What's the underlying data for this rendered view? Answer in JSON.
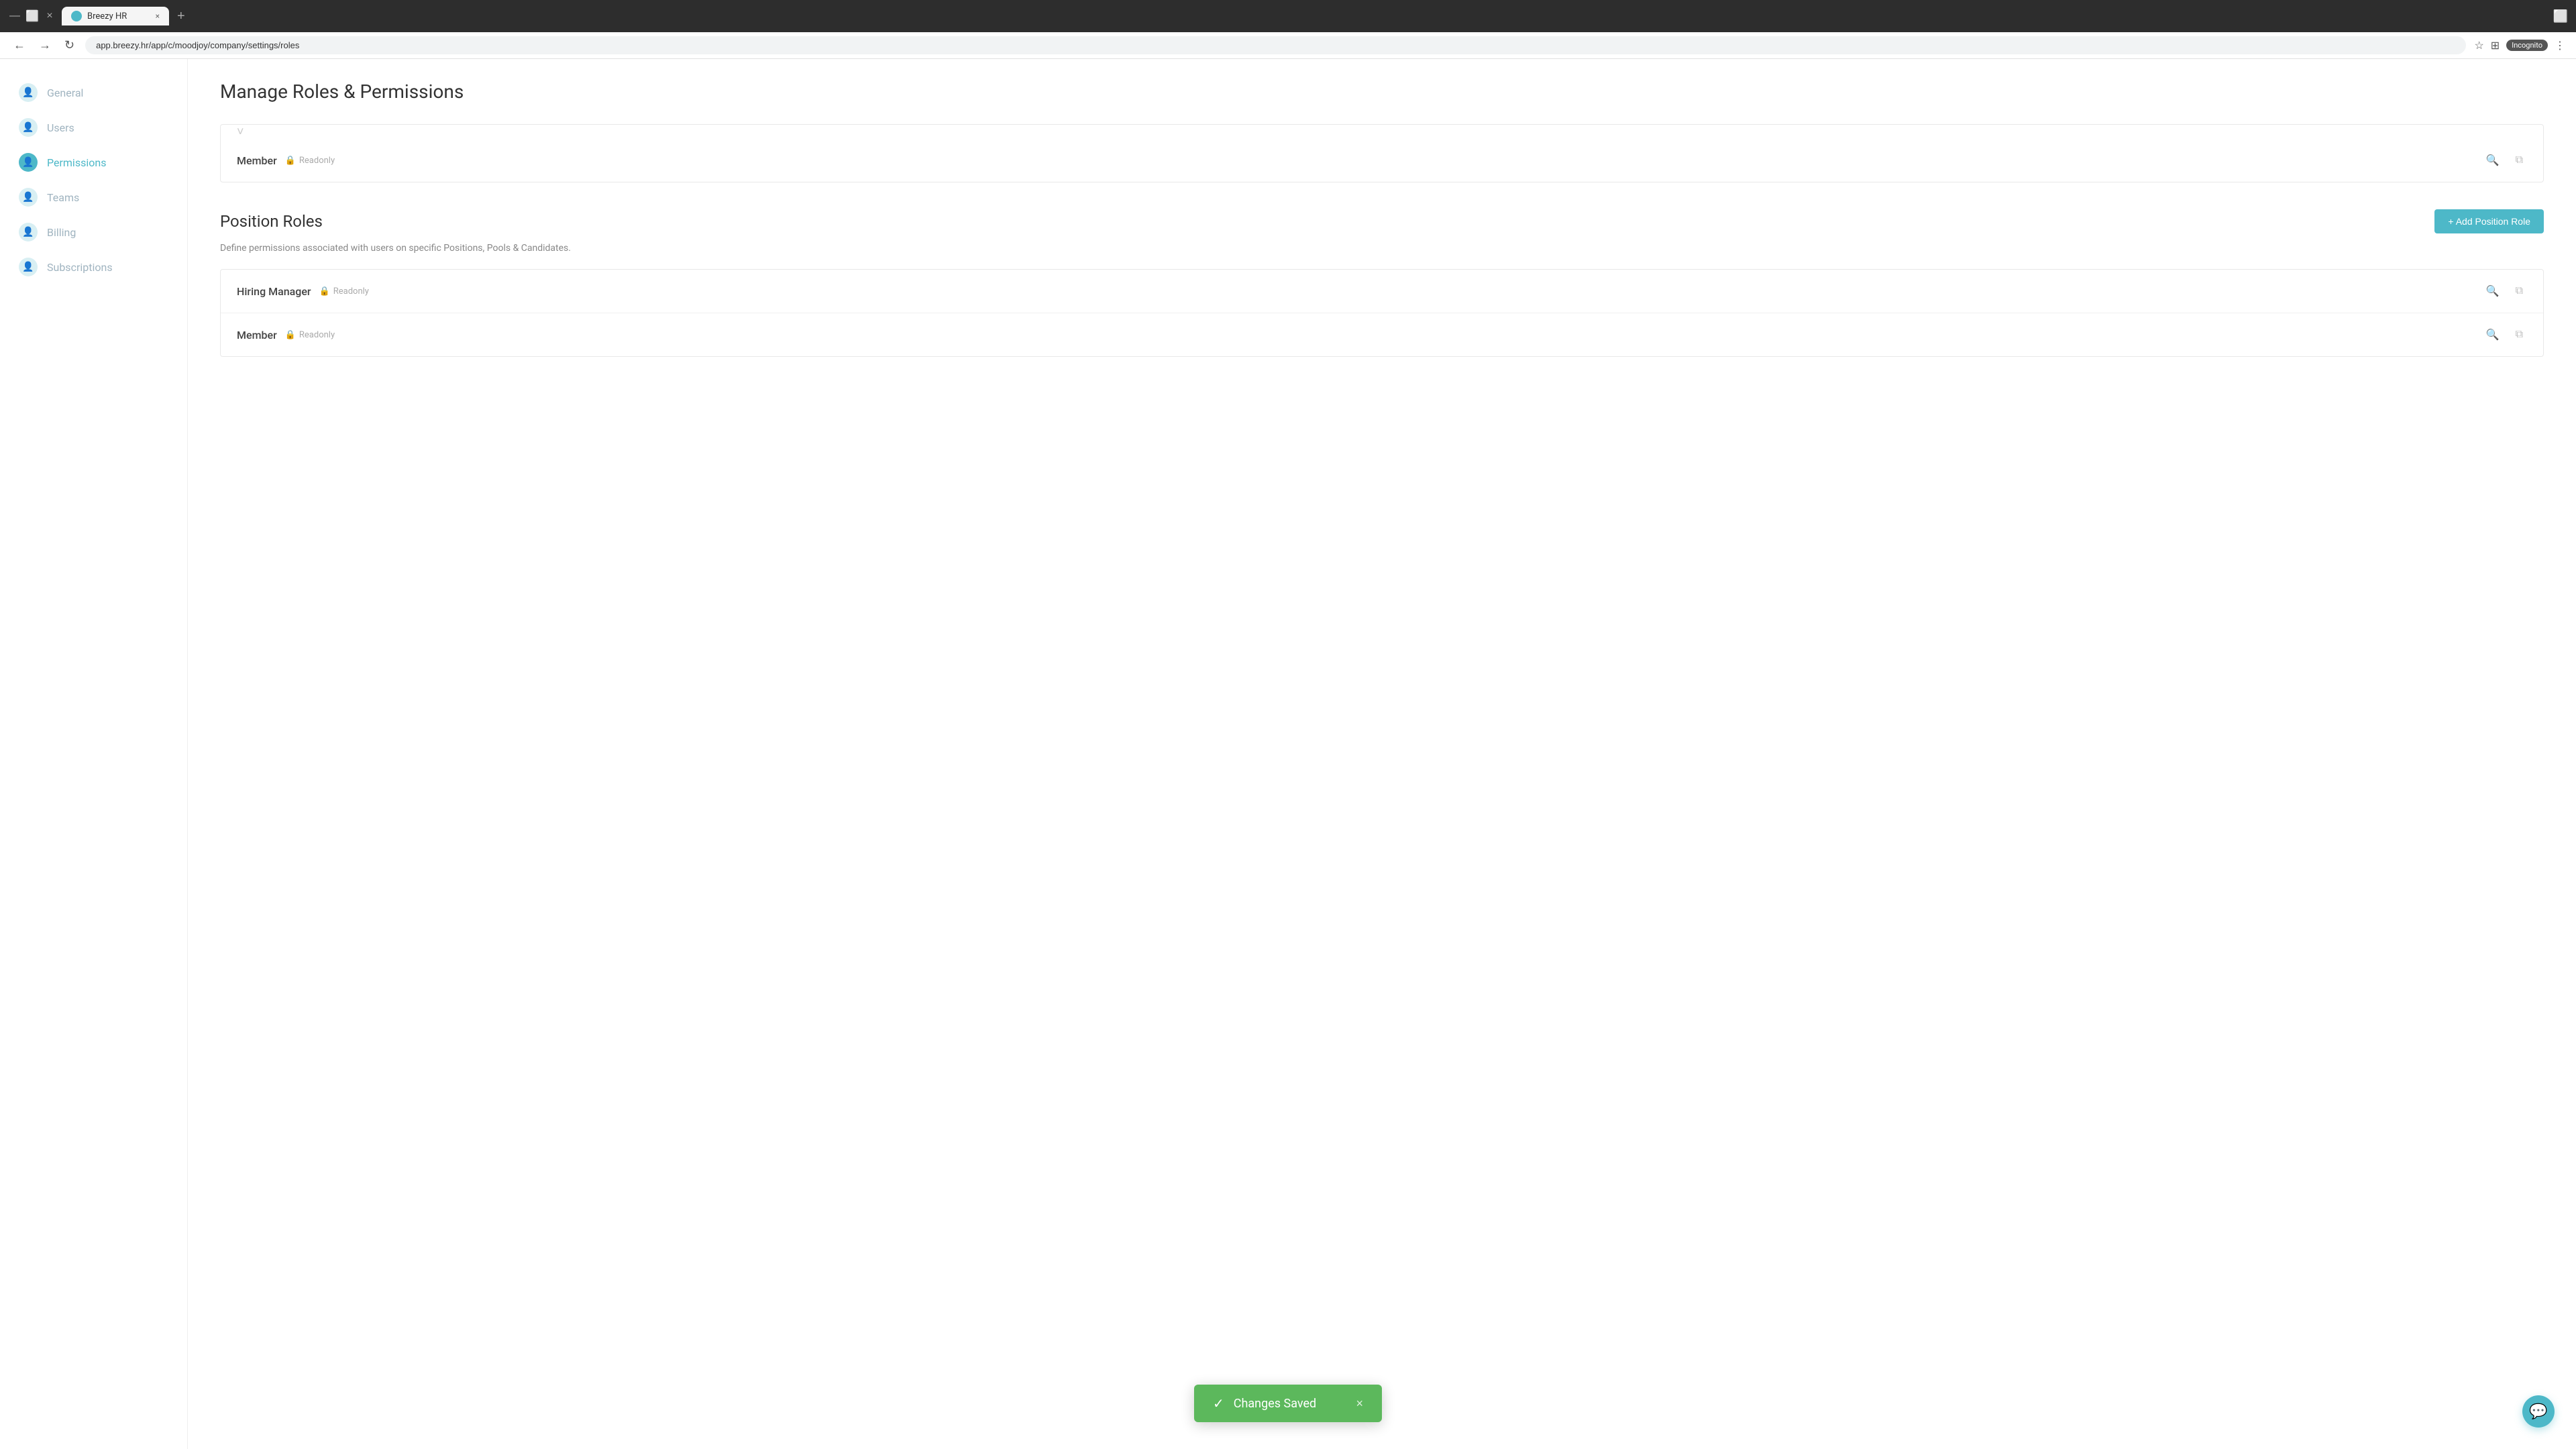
{
  "browser": {
    "tab_title": "Breezy HR",
    "url": "app.breezy.hr/app/c/moodjoy/company/settings/roles",
    "incognito_label": "Incognito"
  },
  "sidebar": {
    "items": [
      {
        "id": "general",
        "label": "General",
        "active": false
      },
      {
        "id": "users",
        "label": "Users",
        "active": false
      },
      {
        "id": "permissions",
        "label": "Permissions",
        "active": true
      },
      {
        "id": "teams",
        "label": "Teams",
        "active": false
      },
      {
        "id": "billing",
        "label": "Billing",
        "active": false
      },
      {
        "id": "subscriptions",
        "label": "Subscriptions",
        "active": false
      }
    ]
  },
  "main": {
    "page_title": "Manage Roles & Permissions",
    "partial_card": {
      "role_name": "Member",
      "badge_label": "Readonly"
    },
    "position_roles_section": {
      "title": "Position Roles",
      "add_button_label": "+ Add Position Role",
      "description": "Define permissions associated with users on specific Positions, Pools & Candidates.",
      "roles": [
        {
          "name": "Hiring Manager",
          "badge": "Readonly"
        },
        {
          "name": "Member",
          "badge": "Readonly"
        }
      ]
    }
  },
  "toast": {
    "message": "Changes Saved",
    "check_icon": "✓",
    "close_icon": "×"
  },
  "icons": {
    "lock": "🔒",
    "search": "🔍",
    "copy": "⧉",
    "chat": "💬",
    "back": "←",
    "forward": "→",
    "refresh": "↻",
    "bookmark": "☆",
    "extensions": "⊞",
    "window": "⬜",
    "menu": "⋮",
    "close_tab": "×",
    "new_tab": "+",
    "minimize": "—",
    "maximize": "⬜",
    "close_window": "×",
    "chevron_down": "˅",
    "person": "👤"
  }
}
